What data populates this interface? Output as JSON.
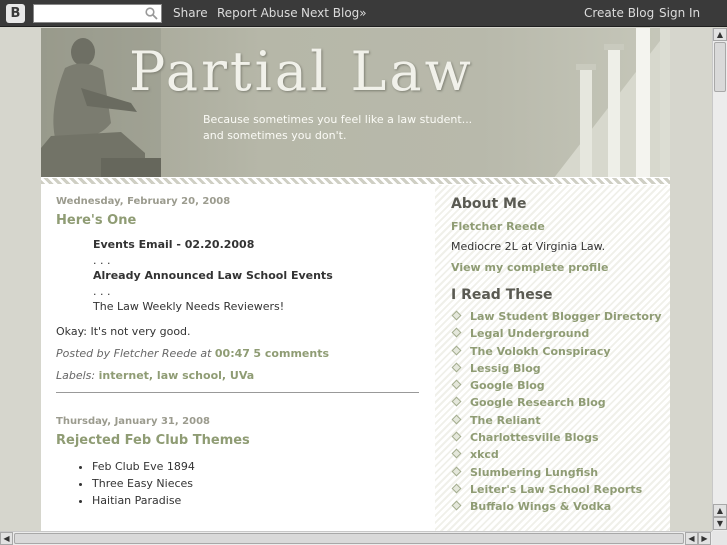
{
  "navbar": {
    "logo": "B",
    "search_placeholder": "",
    "share": "Share",
    "report_abuse": "Report Abuse",
    "next_blog": "Next Blog»",
    "create_blog": "Create Blog",
    "sign_in": "Sign In"
  },
  "header": {
    "title": "Partial Law",
    "description_line1": "Because sometimes you feel like a law student...",
    "description_line2": "and sometimes you don't."
  },
  "posts": [
    {
      "date": "Wednesday, February 20, 2008",
      "title": "Here's One",
      "lines": [
        {
          "text": "Events Email - 02.20.2008",
          "bold": true
        },
        {
          "text": ". . .",
          "bold": false
        },
        {
          "text": "Already Announced Law School Events",
          "bold": true
        },
        {
          "text": ". . .",
          "bold": false
        },
        {
          "text": "The Law Weekly Needs Reviewers!",
          "bold": false
        }
      ],
      "body": "Okay: It's not very good.",
      "posted_by": "Posted by Fletcher Reede at",
      "time": "00:47",
      "comments": "5 comments",
      "labels_prefix": "Labels:",
      "labels": "internet, law school, UVa"
    },
    {
      "date": "Thursday, January 31, 2008",
      "title": "Rejected Feb Club Themes",
      "bullets": [
        "Feb Club Eve 1894",
        "Three Easy Nieces",
        "Haitian Paradise"
      ]
    }
  ],
  "sidebar": {
    "about_heading": "About Me",
    "author_name": "Fletcher Reede",
    "author_bio": "Mediocre 2L at Virginia Law.",
    "profile_link": "View my complete profile",
    "read_heading": "I Read These",
    "links": [
      "Law Student Blogger Directory",
      "Legal Underground",
      "The Volokh Conspiracy",
      "Lessig Blog",
      "Google Blog",
      "Google Research Blog",
      "The Reliant",
      "Charlottesville Blogs",
      "xkcd",
      "Slumbering Lungfish",
      "Leiter's Law School Reports",
      "Buffalo Wings & Vodka"
    ]
  },
  "colors": {
    "navbar_bg": "#3a3a3a",
    "page_bg": "#d6d6cd",
    "link_green": "#8f9c74",
    "text": "#333333"
  }
}
